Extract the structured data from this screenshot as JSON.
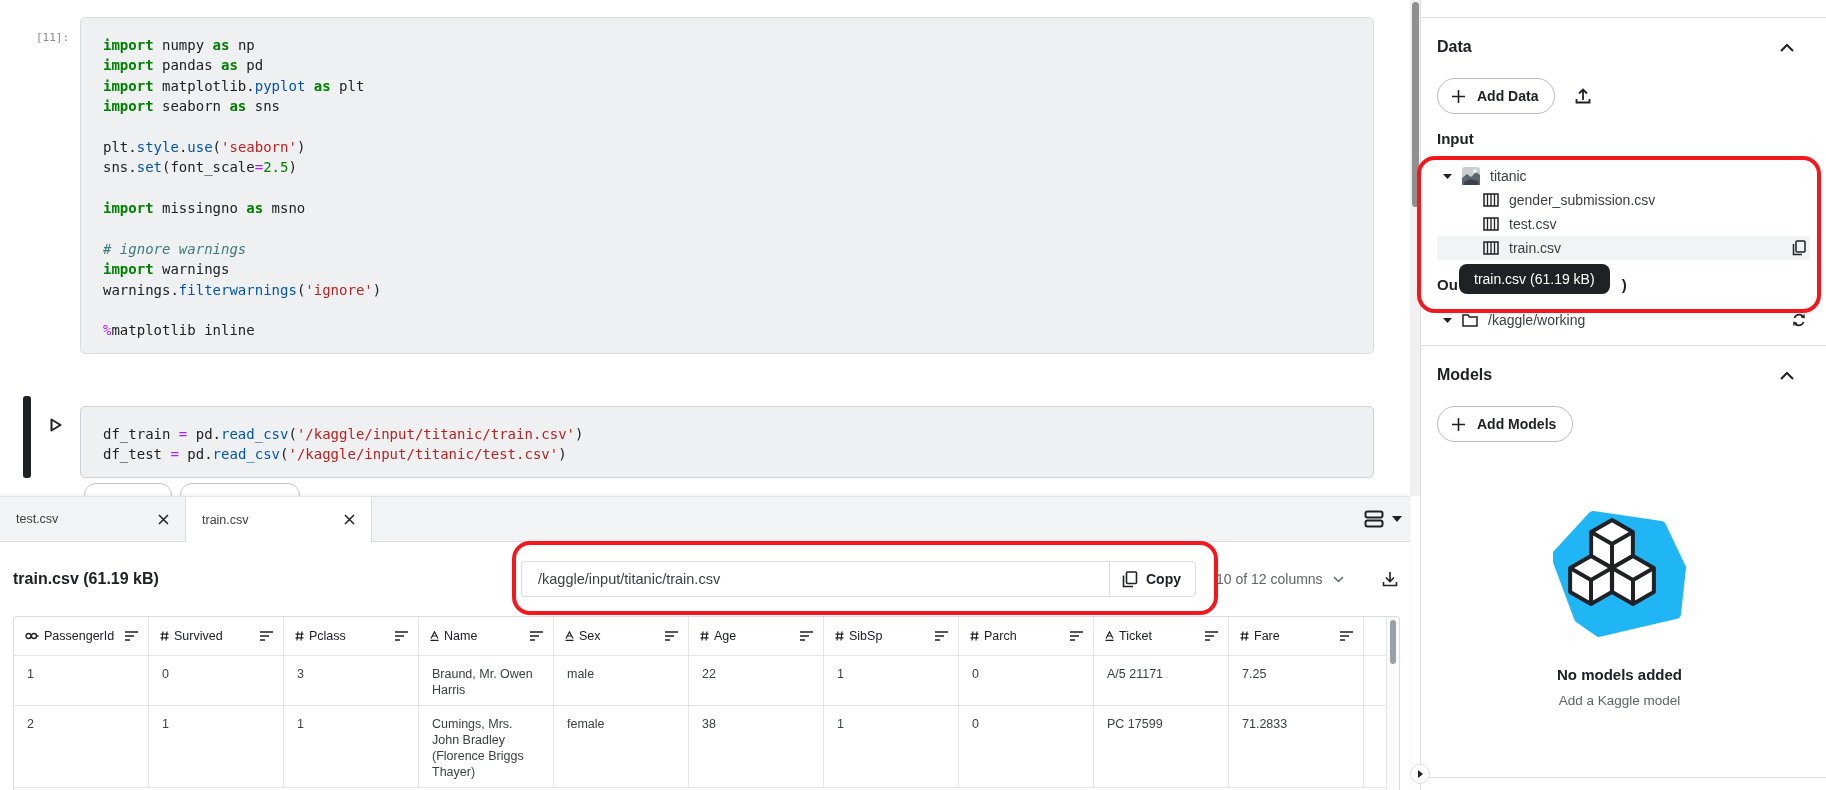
{
  "notebook": {
    "cells": [
      {
        "prompt": "[11]:",
        "selected": false,
        "lines": [
          {
            "kind": "code",
            "tokens": [
              {
                "kind": "kw",
                "text": "import"
              },
              {
                "kind": "plain",
                "text": " numpy "
              },
              {
                "kind": "kw",
                "text": "as"
              },
              {
                "kind": "plain",
                "text": " np"
              }
            ]
          },
          {
            "kind": "code",
            "tokens": [
              {
                "kind": "kw",
                "text": "import"
              },
              {
                "kind": "plain",
                "text": " pandas "
              },
              {
                "kind": "kw",
                "text": "as"
              },
              {
                "kind": "plain",
                "text": " pd"
              }
            ]
          },
          {
            "kind": "code",
            "tokens": [
              {
                "kind": "kw",
                "text": "import"
              },
              {
                "kind": "plain",
                "text": " matplotlib."
              },
              {
                "kind": "attr",
                "text": "pyplot"
              },
              {
                "kind": "kw",
                "text": " as"
              },
              {
                "kind": "plain",
                "text": " plt"
              }
            ]
          },
          {
            "kind": "code",
            "tokens": [
              {
                "kind": "kw",
                "text": "import"
              },
              {
                "kind": "plain",
                "text": " seaborn "
              },
              {
                "kind": "kw",
                "text": "as"
              },
              {
                "kind": "plain",
                "text": " sns"
              }
            ]
          },
          {
            "kind": "blank"
          },
          {
            "kind": "code",
            "tokens": [
              {
                "kind": "plain",
                "text": "plt."
              },
              {
                "kind": "attr",
                "text": "style"
              },
              {
                "kind": "plain",
                "text": "."
              },
              {
                "kind": "attr",
                "text": "use"
              },
              {
                "kind": "plain",
                "text": "("
              },
              {
                "kind": "str",
                "text": "'seaborn'"
              },
              {
                "kind": "plain",
                "text": ")"
              }
            ]
          },
          {
            "kind": "code",
            "tokens": [
              {
                "kind": "plain",
                "text": "sns."
              },
              {
                "kind": "attr",
                "text": "set"
              },
              {
                "kind": "plain",
                "text": "(font_scale"
              },
              {
                "kind": "op",
                "text": "="
              },
              {
                "kind": "num",
                "text": "2.5"
              },
              {
                "kind": "plain",
                "text": ")"
              }
            ]
          },
          {
            "kind": "blank"
          },
          {
            "kind": "code",
            "tokens": [
              {
                "kind": "kw",
                "text": "import"
              },
              {
                "kind": "plain",
                "text": " missingno "
              },
              {
                "kind": "kw",
                "text": "as"
              },
              {
                "kind": "plain",
                "text": " msno"
              }
            ]
          },
          {
            "kind": "blank"
          },
          {
            "kind": "code",
            "tokens": [
              {
                "kind": "comment",
                "text": "# ignore warnings"
              }
            ]
          },
          {
            "kind": "code",
            "tokens": [
              {
                "kind": "kw",
                "text": "import"
              },
              {
                "kind": "plain",
                "text": " warnings"
              }
            ]
          },
          {
            "kind": "code",
            "tokens": [
              {
                "kind": "plain",
                "text": "warnings."
              },
              {
                "kind": "attr",
                "text": "filterwarnings"
              },
              {
                "kind": "plain",
                "text": "("
              },
              {
                "kind": "str",
                "text": "'ignore'"
              },
              {
                "kind": "plain",
                "text": ")"
              }
            ]
          },
          {
            "kind": "blank"
          },
          {
            "kind": "code",
            "tokens": [
              {
                "kind": "op",
                "text": "%"
              },
              {
                "kind": "plain",
                "text": "matplotlib inline"
              }
            ]
          }
        ]
      },
      {
        "selected": true,
        "lines": [
          {
            "kind": "code",
            "tokens": [
              {
                "kind": "plain",
                "text": "df_train "
              },
              {
                "kind": "op",
                "text": "="
              },
              {
                "kind": "plain",
                "text": " pd."
              },
              {
                "kind": "attr",
                "text": "read_csv"
              },
              {
                "kind": "plain",
                "text": "("
              },
              {
                "kind": "str",
                "text": "'/kaggle/input/titanic/train.csv'"
              },
              {
                "kind": "plain",
                "text": ")"
              }
            ]
          },
          {
            "kind": "code",
            "tokens": [
              {
                "kind": "plain",
                "text": "df_test "
              },
              {
                "kind": "op",
                "text": "="
              },
              {
                "kind": "plain",
                "text": " pd."
              },
              {
                "kind": "attr",
                "text": "read_csv"
              },
              {
                "kind": "plain",
                "text": "("
              },
              {
                "kind": "str",
                "text": "'/kaggle/input/titanic/test.csv'"
              },
              {
                "kind": "plain",
                "text": ")"
              }
            ]
          }
        ]
      }
    ]
  },
  "file_tabs": [
    {
      "label": "test.csv",
      "selected": false
    },
    {
      "label": "train.csv",
      "selected": true
    }
  ],
  "file_view": {
    "title": "train.csv (61.19 kB)",
    "path": "/kaggle/input/titanic/train.csv",
    "copy_label": "Copy",
    "columns_picker": "10 of 12 columns"
  },
  "table": {
    "columns": [
      {
        "label": "PassengerId",
        "kind": "id"
      },
      {
        "label": "Survived",
        "kind": "number"
      },
      {
        "label": "Pclass",
        "kind": "number"
      },
      {
        "label": "Name",
        "kind": "text"
      },
      {
        "label": "Sex",
        "kind": "text"
      },
      {
        "label": "Age",
        "kind": "number"
      },
      {
        "label": "SibSp",
        "kind": "number"
      },
      {
        "label": "Parch",
        "kind": "number"
      },
      {
        "label": "Ticket",
        "kind": "text"
      },
      {
        "label": "Fare",
        "kind": "number"
      }
    ],
    "rows": [
      [
        "1",
        "0",
        "3",
        "Braund, Mr. Owen Harris",
        "male",
        "22",
        "1",
        "0",
        "A/5 21171",
        "7.25"
      ],
      [
        "2",
        "1",
        "1",
        "Cumings, Mrs. John Bradley (Florence Briggs Thayer)",
        "female",
        "38",
        "1",
        "0",
        "PC 17599",
        "71.2833"
      ]
    ]
  },
  "sidebar": {
    "data": {
      "title": "Data",
      "expanded": true,
      "add_label": "Add Data",
      "input_title": "Input",
      "tree": [
        {
          "name": "titanic",
          "kind": "dataset",
          "expanded": true,
          "children": [
            {
              "name": "gender_submission.csv",
              "kind": "file",
              "highlighted": false
            },
            {
              "name": "test.csv",
              "kind": "file",
              "highlighted": false
            },
            {
              "name": "train.csv",
              "kind": "file",
              "highlighted": true
            }
          ]
        }
      ],
      "output_title_start": "Ou",
      "output_title_end": ")",
      "tooltip": "train.csv (61.19 kB)",
      "output_tree": [
        {
          "name": "/kaggle/working",
          "kind": "folder",
          "expanded": true
        }
      ]
    },
    "models": {
      "title": "Models",
      "expanded": true,
      "add_label": "Add Models",
      "empty_title": "No models added",
      "empty_hint": "Add a Kaggle model"
    }
  }
}
